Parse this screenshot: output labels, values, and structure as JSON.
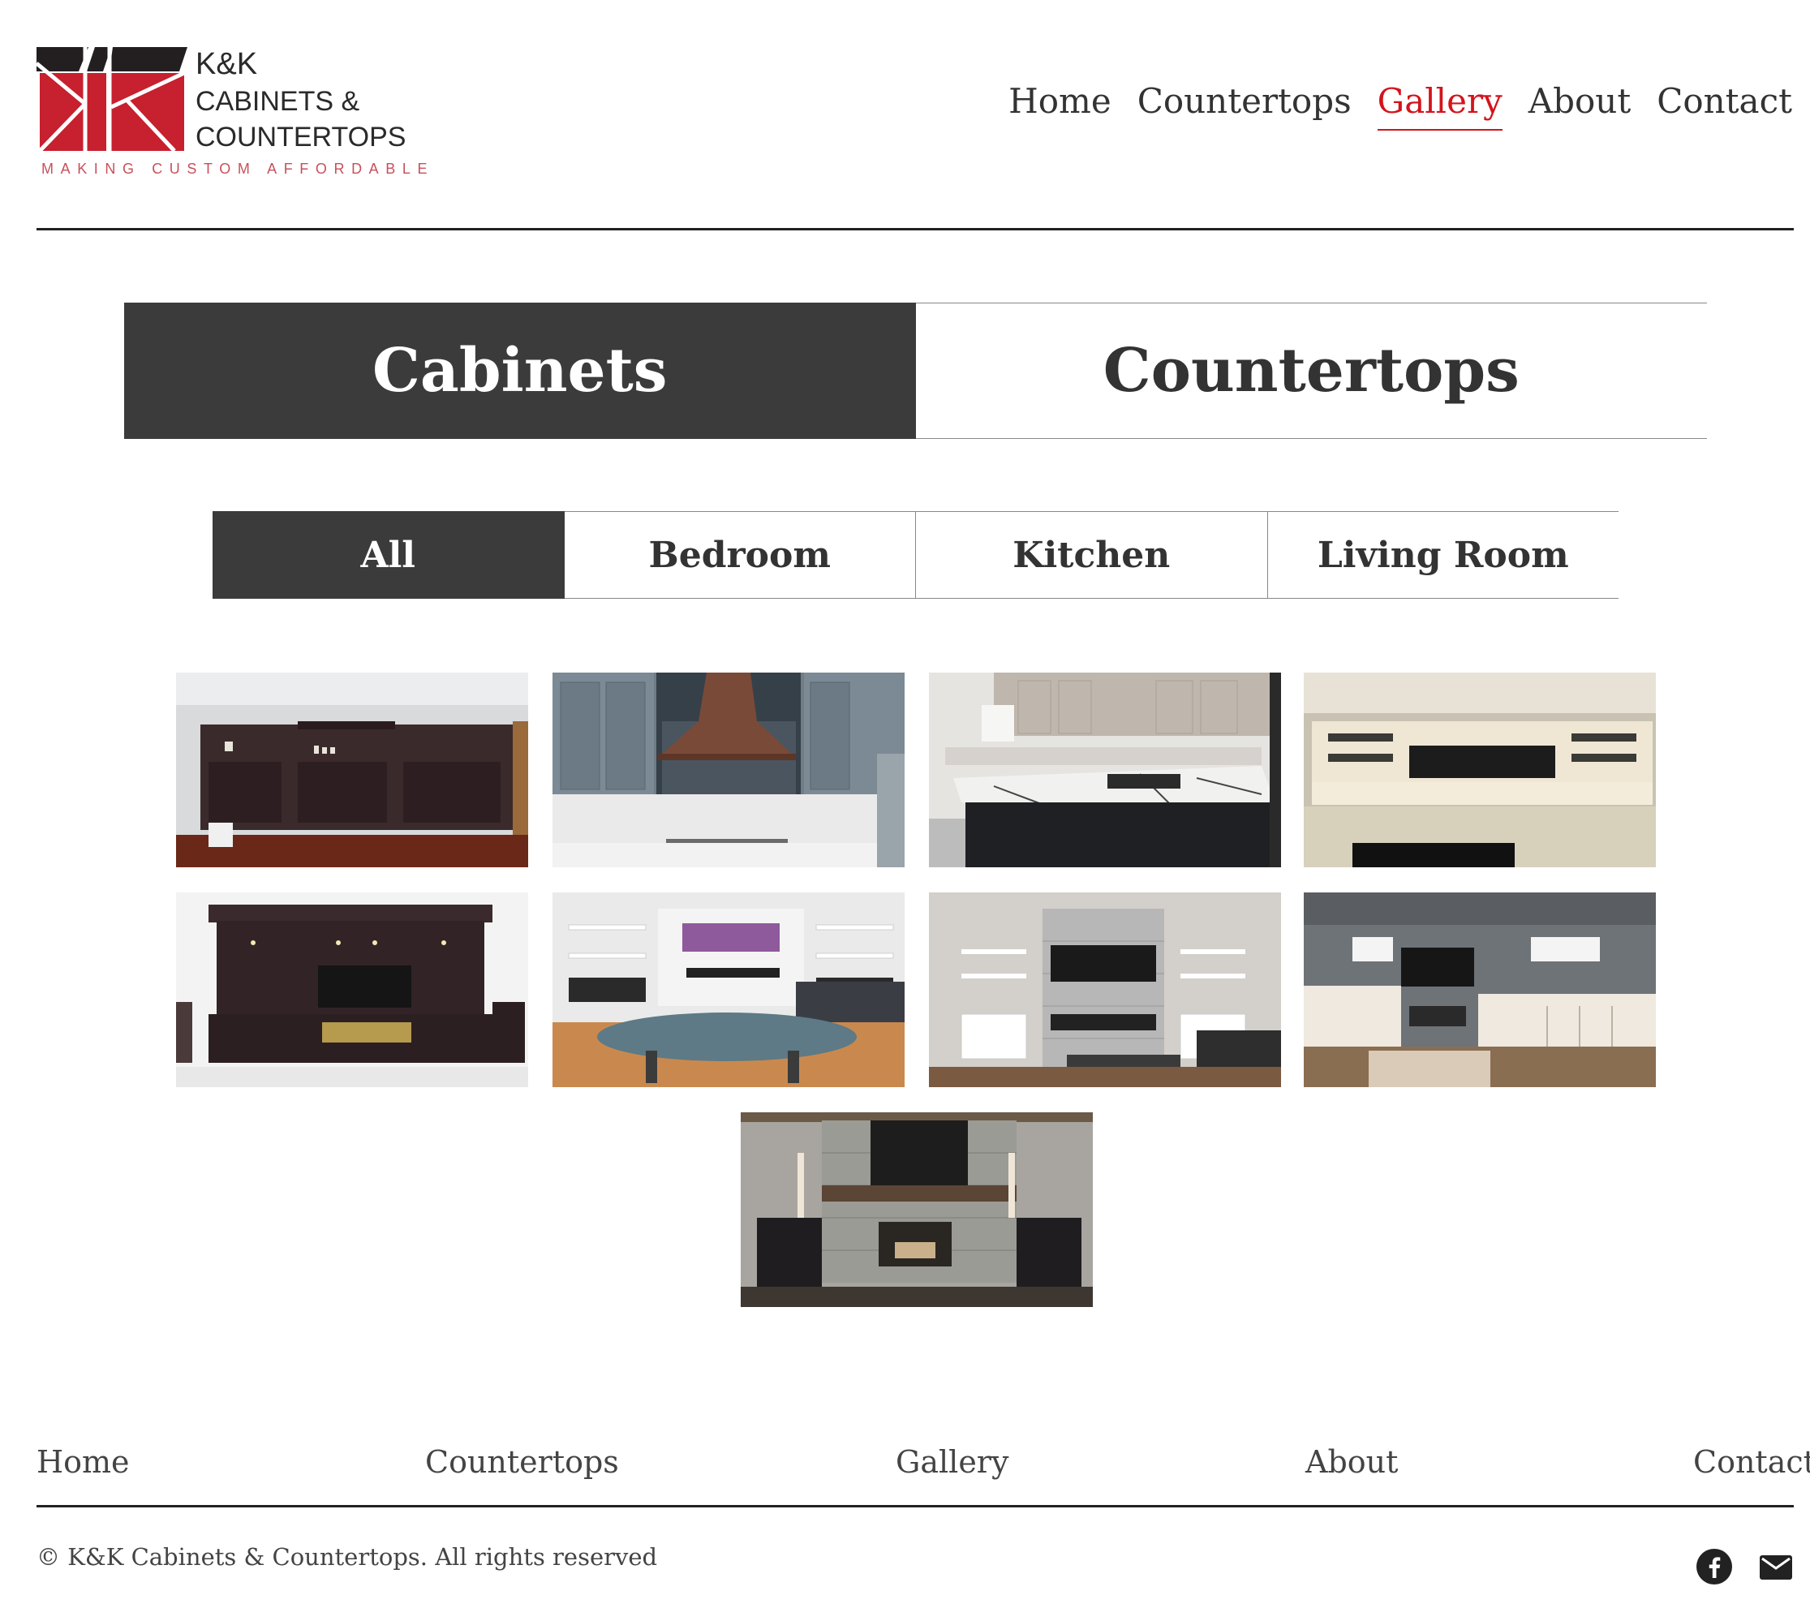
{
  "brand": {
    "line1": "K&K",
    "line2": "CABINETS &",
    "line3": "COUNTERTOPS",
    "tagline": "MAKING CUSTOM AFFORDABLE",
    "colors": {
      "red": "#c7202e",
      "dark": "#231f20"
    }
  },
  "nav": {
    "items": [
      "Home",
      "Countertops",
      "Gallery",
      "About",
      "Contact"
    ],
    "active": "Gallery",
    "active_color": "#d3141c"
  },
  "category_tabs": {
    "items": [
      "Cabinets",
      "Countertops"
    ],
    "active": "Cabinets"
  },
  "filter_tabs": {
    "items": [
      "All",
      "Bedroom",
      "Kitchen",
      "Living Room"
    ],
    "active": "All"
  },
  "gallery": {
    "photos": [
      {
        "subject": "dark wood wall unit with shelving"
      },
      {
        "subject": "grey kitchen cabinets with copper range hood and mosaic backsplash"
      },
      {
        "subject": "kitchen with white marble island and black base"
      },
      {
        "subject": "basement built-in media wall with cream cabinets"
      },
      {
        "subject": "espresso entertainment center with crown moulding"
      },
      {
        "subject": "living room fireplace wall with floating shelves"
      },
      {
        "subject": "stacked stone fireplace with white built-ins"
      },
      {
        "subject": "basement media wall with white cabinets"
      },
      {
        "subject": "stone fireplace with wood mantel and dark side cabinets"
      }
    ]
  },
  "footer": {
    "nav": [
      "Home",
      "Countertops",
      "Gallery",
      "About",
      "Contact"
    ],
    "copyright": "© K&K Cabinets & Countertops. All rights reserved",
    "social": [
      "facebook-icon",
      "email-icon"
    ]
  }
}
